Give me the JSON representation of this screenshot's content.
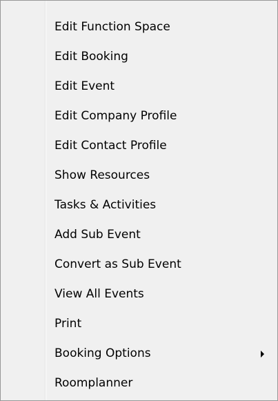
{
  "context_menu": {
    "items": [
      {
        "label": "Edit Function Space"
      },
      {
        "label": "Edit Booking"
      },
      {
        "label": "Edit Event"
      },
      {
        "label": "Edit Company Profile"
      },
      {
        "label": "Edit Contact Profile"
      },
      {
        "label": "Show Resources"
      },
      {
        "label": "Tasks & Activities"
      },
      {
        "label": "Add Sub Event"
      },
      {
        "label": "Convert as Sub Event"
      },
      {
        "label": "View All Events"
      },
      {
        "label": "Print"
      },
      {
        "label": "Booking Options",
        "submenu_icon": "chevron-right-icon"
      },
      {
        "label": "Roomplanner"
      }
    ]
  }
}
